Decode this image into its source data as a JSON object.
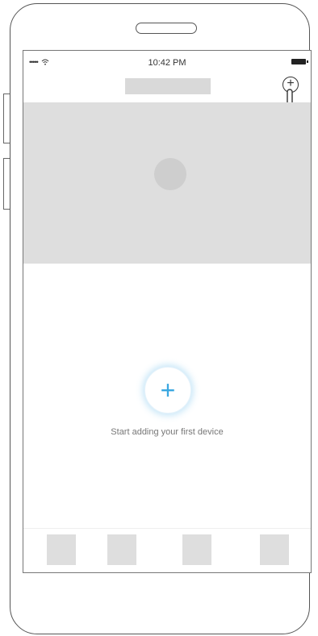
{
  "status_bar": {
    "signal": "•••••",
    "time": "10:42 PM"
  },
  "header": {
    "add_symbol": "+"
  },
  "empty_state": {
    "add_symbol": "+",
    "message": "Start adding your first device"
  },
  "colors": {
    "accent": "#3aa7e0",
    "placeholder": "#dedede"
  },
  "icons": {
    "wifi": "wifi-icon",
    "battery": "battery-icon",
    "add": "add-circle-icon",
    "hand": "pointing-hand-icon"
  }
}
